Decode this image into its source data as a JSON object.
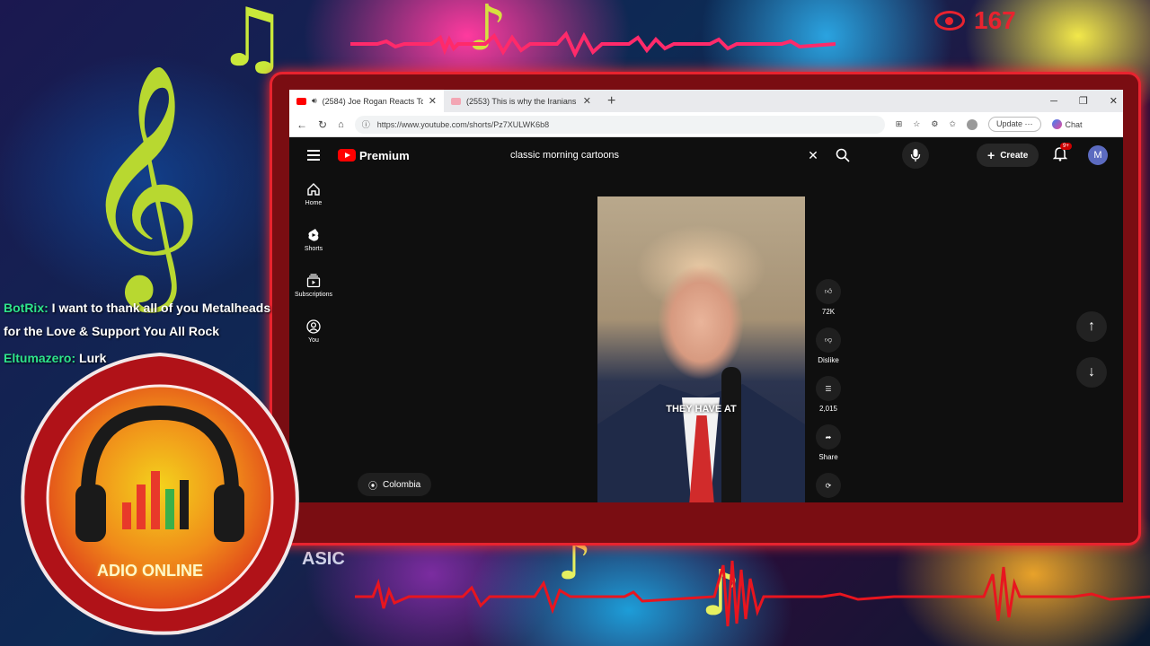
{
  "overlay": {
    "viewer_count": "167",
    "radio_logo_text": "ADIO ONLINE",
    "bg_text_left": "ASIC",
    "chat": [
      {
        "user": "BotRix:",
        "message": "I want to thank all of you Metalheads for the Love & Support You All Rock"
      },
      {
        "user": "Eltumazero:",
        "message": "Lurk"
      }
    ]
  },
  "browser": {
    "tabs": [
      {
        "title": "(2584) Joe Rogan Reacts To D",
        "active": true
      },
      {
        "title": "(2553) This is why the Iranians are",
        "active": false
      }
    ],
    "url": "https://www.youtube.com/shorts/Pz7XULWK6b8",
    "update_label": "Update",
    "chat_label": "Chat"
  },
  "youtube": {
    "brand": "Premium",
    "search_query": "classic morning cartoons",
    "create_label": "Create",
    "notif_badge": "9+",
    "avatar_letter": "M",
    "sidebar": [
      {
        "label": "Home",
        "icon": "home-icon"
      },
      {
        "label": "Shorts",
        "icon": "shorts-icon"
      },
      {
        "label": "Subscriptions",
        "icon": "subscriptions-icon"
      },
      {
        "label": "You",
        "icon": "you-icon"
      }
    ],
    "video_caption": "THEY HAVE AT",
    "actions": {
      "likes": "72K",
      "dislike_label": "Dislike",
      "comments": "2,015",
      "share_label": "Share"
    },
    "location_chip": "Colombia"
  },
  "colors": {
    "accent_red": "#e8232f",
    "yt_red": "#ff0000",
    "chat_user_green": "#2ee58c"
  }
}
